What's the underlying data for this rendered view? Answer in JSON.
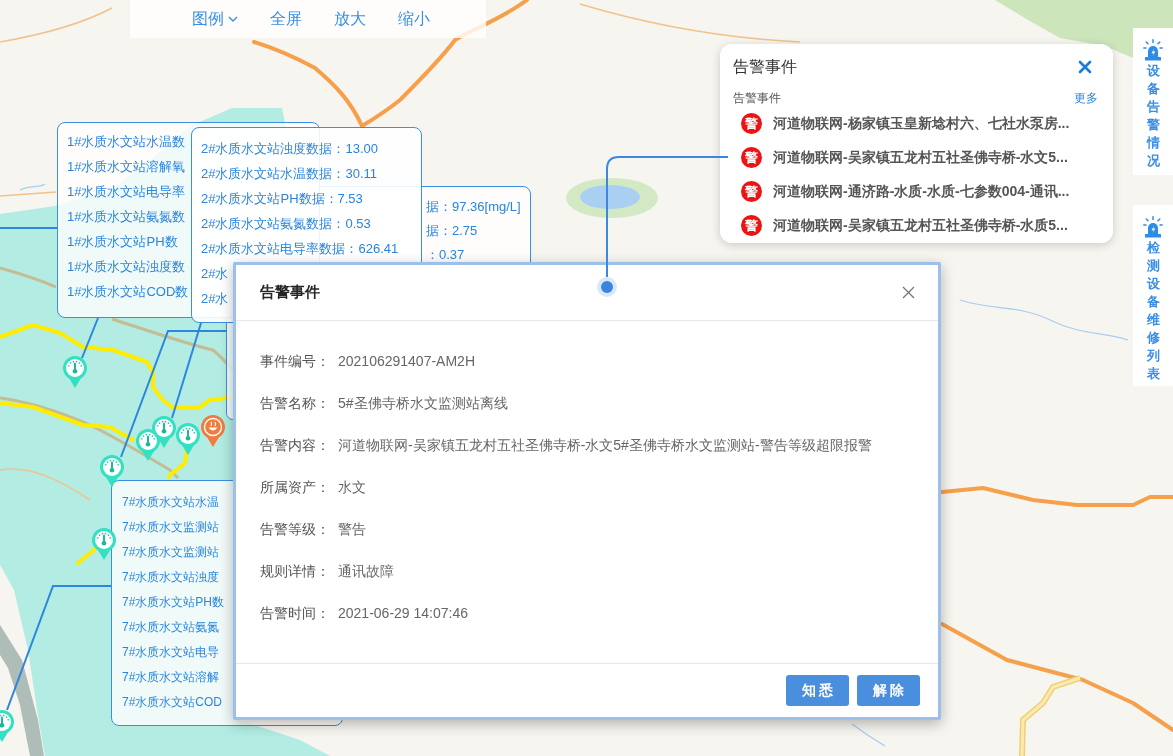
{
  "toolbar": {
    "items": [
      {
        "kind": "dropdown",
        "label": "图例"
      },
      {
        "kind": "button",
        "label": "全屏"
      },
      {
        "kind": "button",
        "label": "放大"
      },
      {
        "kind": "button",
        "label": "缩小"
      }
    ]
  },
  "data_popups": [
    {
      "rows": [
        "1#水质水文站水温数",
        "1#水质水文站溶解氧",
        "1#水质水文站电导率",
        "1#水质水文站氨氮数",
        "1#水质水文站PH数",
        "1#水质水文站浊度数",
        "1#水质水文站COD数"
      ]
    },
    {
      "rows": [
        "2#水质水文站浊度数据：13.00",
        "2#水质水文站水温数据：30.11",
        "2#水质水文站PH数据：7.53",
        "2#水质水文站氨氮数据：0.53",
        "2#水质水文站电导率数据：626.41",
        "2#水",
        "2#水"
      ]
    },
    {
      "rows": [
        "据：97.36[mg/L]",
        "据：2.75",
        "：0.37"
      ]
    },
    {
      "rows": [
        "7#水质水文站水温",
        "7#水质水文监测站",
        "7#水质水文监测站",
        "7#水质水文站浊度",
        "7#水质水文站PH数",
        "7#水质水文站氨氮",
        "7#水质水文站电导",
        "7#水质水文站溶解",
        "7#水质水文站COD"
      ]
    }
  ],
  "alert_panel": {
    "title": "告警事件",
    "subtitle": "告警事件",
    "more": "更多",
    "items": [
      {
        "badge": "警",
        "text": "河道物联网-杨家镇玉皇新埝村六、七社水泵房..."
      },
      {
        "badge": "警",
        "text": "河道物联网-吴家镇五龙村五社圣佛寺桥-水文5..."
      },
      {
        "badge": "警",
        "text": "河道物联网-通济路-水质-水质-七参数004-通讯..."
      },
      {
        "badge": "警",
        "text": "河道物联网-吴家镇五龙村五社圣佛寺桥-水质5..."
      }
    ]
  },
  "side_tabs": [
    {
      "label": "设备告警情况"
    },
    {
      "label": "检测设备维修列表"
    }
  ],
  "modal": {
    "title": "告警事件",
    "fields": [
      {
        "label": "事件编号：",
        "value": "202106291407-AM2H"
      },
      {
        "label": "告警名称：",
        "value": "5#圣佛寺桥水文监测站离线"
      },
      {
        "label": "告警内容：",
        "value": "河道物联网-吴家镇五龙村五社圣佛寺桥-水文5#圣佛寺桥水文监测站-警告等级超限报警"
      },
      {
        "label": "所属资产：",
        "value": "水文"
      },
      {
        "label": "告警等级：",
        "value": "警告"
      },
      {
        "label": "规则详情：",
        "value": "通讯故障"
      },
      {
        "label": "告警时间：",
        "value": "2021-06-29 14:07:46"
      }
    ],
    "buttons": [
      "知 悉",
      "解 除"
    ]
  }
}
